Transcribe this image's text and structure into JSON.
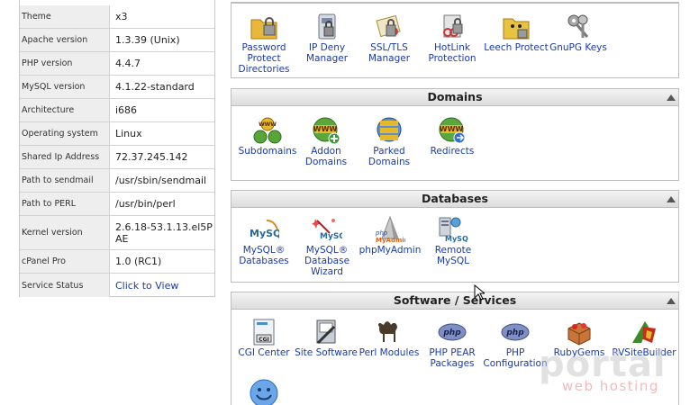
{
  "stats": [
    {
      "key": "Theme",
      "value": "x3"
    },
    {
      "key": "Apache version",
      "value": "1.3.39 (Unix)"
    },
    {
      "key": "PHP version",
      "value": "4.4.7"
    },
    {
      "key": "MySQL version",
      "value": "4.1.22-standard"
    },
    {
      "key": "Architecture",
      "value": "i686"
    },
    {
      "key": "Operating system",
      "value": "Linux"
    },
    {
      "key": "Shared Ip Address",
      "value": "72.37.245.142"
    },
    {
      "key": "Path to sendmail",
      "value": "/usr/sbin/sendmail"
    },
    {
      "key": "Path to PERL",
      "value": "/usr/bin/perl"
    },
    {
      "key": "Kernel version",
      "value": "2.6.18-53.1.13.el5PAE"
    },
    {
      "key": "cPanel Pro",
      "value": "1.0 (RC1)"
    },
    {
      "key": "Service Status",
      "value": "Click to View"
    }
  ],
  "security": {
    "items": [
      {
        "label": "Password Protect Directories",
        "icon": "folder-lock-icon"
      },
      {
        "label": "IP Deny Manager",
        "icon": "ip-deny-icon"
      },
      {
        "label": "SSL/TLS Manager",
        "icon": "ssl-certificate-icon"
      },
      {
        "label": "HotLink Protection",
        "icon": "hotlink-icon"
      },
      {
        "label": "Leech Protect",
        "icon": "leech-folder-icon"
      },
      {
        "label": "GnuPG Keys",
        "icon": "keys-icon"
      }
    ]
  },
  "domains": {
    "title": "Domains",
    "items": [
      {
        "label": "Subdomains",
        "icon": "subdomains-www-icon"
      },
      {
        "label": "Addon Domains",
        "icon": "addon-www-icon"
      },
      {
        "label": "Parked Domains",
        "icon": "parked-www-icon"
      },
      {
        "label": "Redirects",
        "icon": "redirect-www-icon"
      }
    ]
  },
  "databases": {
    "title": "Databases",
    "items": [
      {
        "label": "MySQL® Databases",
        "icon": "mysql-icon"
      },
      {
        "label": "MySQL® Database Wizard",
        "icon": "mysql-wizard-icon"
      },
      {
        "label": "phpMyAdmin",
        "icon": "phpmyadmin-icon"
      },
      {
        "label": "Remote MySQL",
        "icon": "remote-mysql-icon"
      }
    ]
  },
  "software": {
    "title": "Software / Services",
    "items": [
      {
        "label": "CGI Center",
        "icon": "cgi-icon"
      },
      {
        "label": "Site Software",
        "icon": "site-software-icon"
      },
      {
        "label": "Perl Modules",
        "icon": "perl-camel-icon"
      },
      {
        "label": "PHP PEAR Packages",
        "icon": "php-pear-icon"
      },
      {
        "label": "PHP Configuration",
        "icon": "php-config-icon"
      },
      {
        "label": "RubyGems",
        "icon": "rubygems-icon"
      },
      {
        "label": "RVSiteBuilder",
        "icon": "rvsitebuilder-icon"
      },
      {
        "label": "",
        "icon": "smiley-icon"
      }
    ]
  },
  "watermark": {
    "line1": "portal",
    "line2": "web hosting"
  }
}
